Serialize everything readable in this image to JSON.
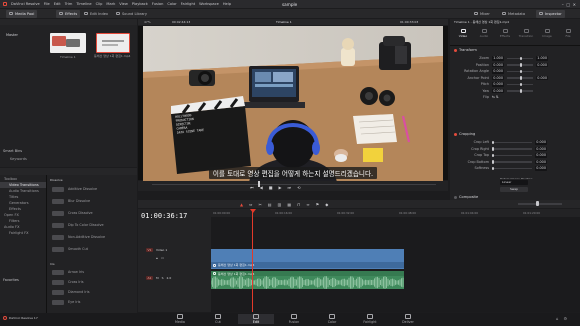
{
  "menubar": {
    "app_name": "DaVinci Resolve",
    "items": [
      "File",
      "Edit",
      "Trim",
      "Timeline",
      "Clip",
      "Mark",
      "View",
      "Playback",
      "Fusion",
      "Color",
      "Fairlight",
      "Workspace",
      "Help"
    ],
    "project_title": "sample"
  },
  "toolbar": {
    "media_pool": "Media Pool",
    "effects": "Effects",
    "edit_index": "Edit Index",
    "sound_library": "Sound Library",
    "mixer": "Mixer",
    "metadata": "Metadata",
    "inspector": "Inspector"
  },
  "viewer": {
    "zoom": "47%",
    "timecode_left": "00:02:44:13",
    "timeline_name": "Timeline 1",
    "timecode_right": "01:00:33:03",
    "subtitle": "이를 토대로 영상 편집을 어떻게 하는지 설명드리겠습니다.",
    "clapper_lines": [
      "HOLLYWOOD",
      "PRODUCTION",
      "DIRECTOR",
      "CAMERA",
      "DATA",
      "SCENE",
      "TAKE"
    ]
  },
  "media_pool": {
    "bins": [
      "Master"
    ],
    "clips": [
      "Timeline 1",
      "동해선 영상 1회 편집1.mp4"
    ],
    "smart_bins_label": "Smart Bins",
    "smart_bins_items": [
      "Keywords"
    ]
  },
  "effects_panel": {
    "tree": [
      "Toolbox",
      "Video Transitions",
      "Audio Transitions",
      "Titles",
      "Generators",
      "Effects",
      "Open FX",
      "Filters",
      "Audio FX",
      "Fairlight FX"
    ],
    "favorites_label": "Favorites",
    "transitions_header": "Dissolve",
    "transitions": [
      "Additive Dissolve",
      "Blur Dissolve",
      "Cross Dissolve",
      "Dip To Color Dissolve",
      "Non-Additive Dissolve",
      "Smooth Cut"
    ],
    "iris_header": "Iris",
    "iris_items": [
      "Arrow Iris",
      "Cross Iris",
      "Diamond Iris",
      "Eye Iris"
    ]
  },
  "inspector": {
    "title": "Timeline 1 - 동해선 영상 1회 편집1.mp4",
    "tabs": [
      "Video",
      "Audio",
      "Effects",
      "Transition",
      "Image",
      "File"
    ],
    "transform_header": "Transform",
    "transform_rows": [
      {
        "label": "Zoom",
        "x": "1.000",
        "y": "1.000"
      },
      {
        "label": "Position",
        "x": "0.000",
        "y": "0.000"
      },
      {
        "label": "Rotation Angle",
        "x": "0.000",
        "y": ""
      },
      {
        "label": "Anchor Point",
        "x": "0.000",
        "y": "0.000"
      },
      {
        "label": "Pitch",
        "x": "0.000",
        "y": ""
      },
      {
        "label": "Yaw",
        "x": "0.000",
        "y": ""
      },
      {
        "label": "Flip",
        "x": "",
        "y": ""
      }
    ],
    "cropping_header": "Cropping",
    "cropping_rows": [
      {
        "label": "Crop Left",
        "v": "0.000"
      },
      {
        "label": "Crop Right",
        "v": "0.000"
      },
      {
        "label": "Crop Top",
        "v": "0.000"
      },
      {
        "label": "Crop Bottom",
        "v": "0.000"
      },
      {
        "label": "Softness",
        "v": "0.000"
      }
    ],
    "retain_label": "Retain Image Position",
    "dynamic_zoom_header": "Dynamic Zoom",
    "dynamic_zoom_ease": "Linear",
    "swap_label": "Swap",
    "composite_header": "Composite"
  },
  "timeline": {
    "timecode": "01:00:36:17",
    "ruler": [
      "01:00:00:00",
      "01:00:16:00",
      "01:00:32:00",
      "01:00:48:00",
      "01:01:04:00",
      "01:01:20:00"
    ],
    "video_track": {
      "id": "V1",
      "name": "Video 1",
      "clip": "동해선 영상 1회 편집1.mp4"
    },
    "audio_track": {
      "id": "A1",
      "level": "2.0",
      "clip": "동해선 영상 1회 편집1.mp4"
    }
  },
  "pages": [
    "Media",
    "Cut",
    "Edit",
    "Fusion",
    "Color",
    "Fairlight",
    "Deliver"
  ],
  "bottom": {
    "app_label": "DaVinci Resolve 17"
  },
  "colors": {
    "accent": "#e44b3c",
    "video_clip": "#4f7fb6",
    "audio_clip": "#4ea06e",
    "playhead": "#e23a2a"
  }
}
